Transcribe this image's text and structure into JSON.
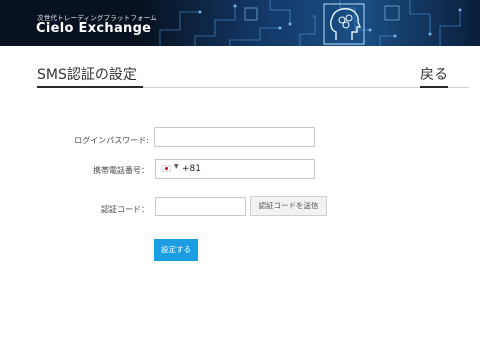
{
  "header": {
    "subtitle": "次世代トレーディングプラットフォーム",
    "brand": "Cielo Exchange"
  },
  "page": {
    "title": "SMS認証の設定",
    "back_label": "戻る"
  },
  "form": {
    "password_label": "ログインパスワード:",
    "password_value": "",
    "phone_label": "携帯電話番号：",
    "phone_country_code": "+81",
    "phone_country_flag": "japan-flag-icon",
    "code_label": "認証コード：",
    "code_value": "",
    "send_code_label": "認証コードを送信",
    "submit_label": "設定する"
  },
  "colors": {
    "banner_bg": "#07111f",
    "primary_button": "#1b9de2",
    "text": "#333333"
  }
}
